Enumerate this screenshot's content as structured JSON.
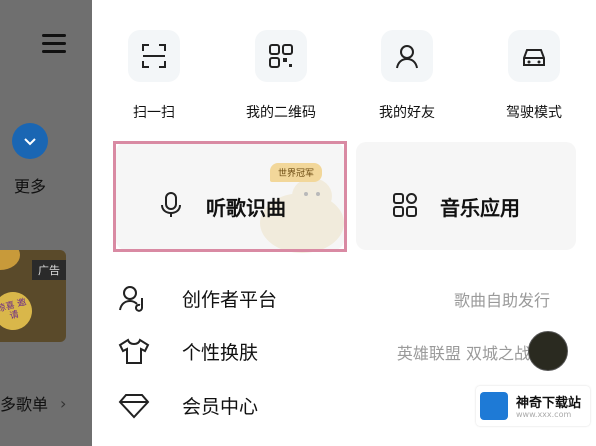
{
  "backdrop": {
    "more_label": "更多",
    "ad_tag": "广告",
    "ad_badge": "惊喜\n邀请",
    "playlist_label": "多歌单",
    "chevron": "›"
  },
  "quick_actions": [
    {
      "label": "扫一扫",
      "icon": "scan-icon"
    },
    {
      "label": "我的二维码",
      "icon": "qrcode-icon"
    },
    {
      "label": "我的好友",
      "icon": "friend-icon"
    },
    {
      "label": "驾驶模式",
      "icon": "car-icon"
    }
  ],
  "cards": [
    {
      "label": "听歌识曲",
      "icon": "microphone-icon",
      "badge": "世界冠军"
    },
    {
      "label": "音乐应用",
      "icon": "apps-grid-icon"
    }
  ],
  "list": [
    {
      "label": "创作者平台",
      "right": "歌曲自助发行",
      "icon": "creator-icon"
    },
    {
      "label": "个性换肤",
      "right": "英雄联盟 双城之战",
      "icon": "shirt-icon"
    },
    {
      "label": "会员中心",
      "right": "",
      "icon": "diamond-icon"
    }
  ],
  "watermark": {
    "title": "神奇下载站",
    "sub": "www.xxx.com"
  },
  "colors": {
    "highlight": "#d98aa3",
    "accent_blue": "#1a66b3"
  }
}
